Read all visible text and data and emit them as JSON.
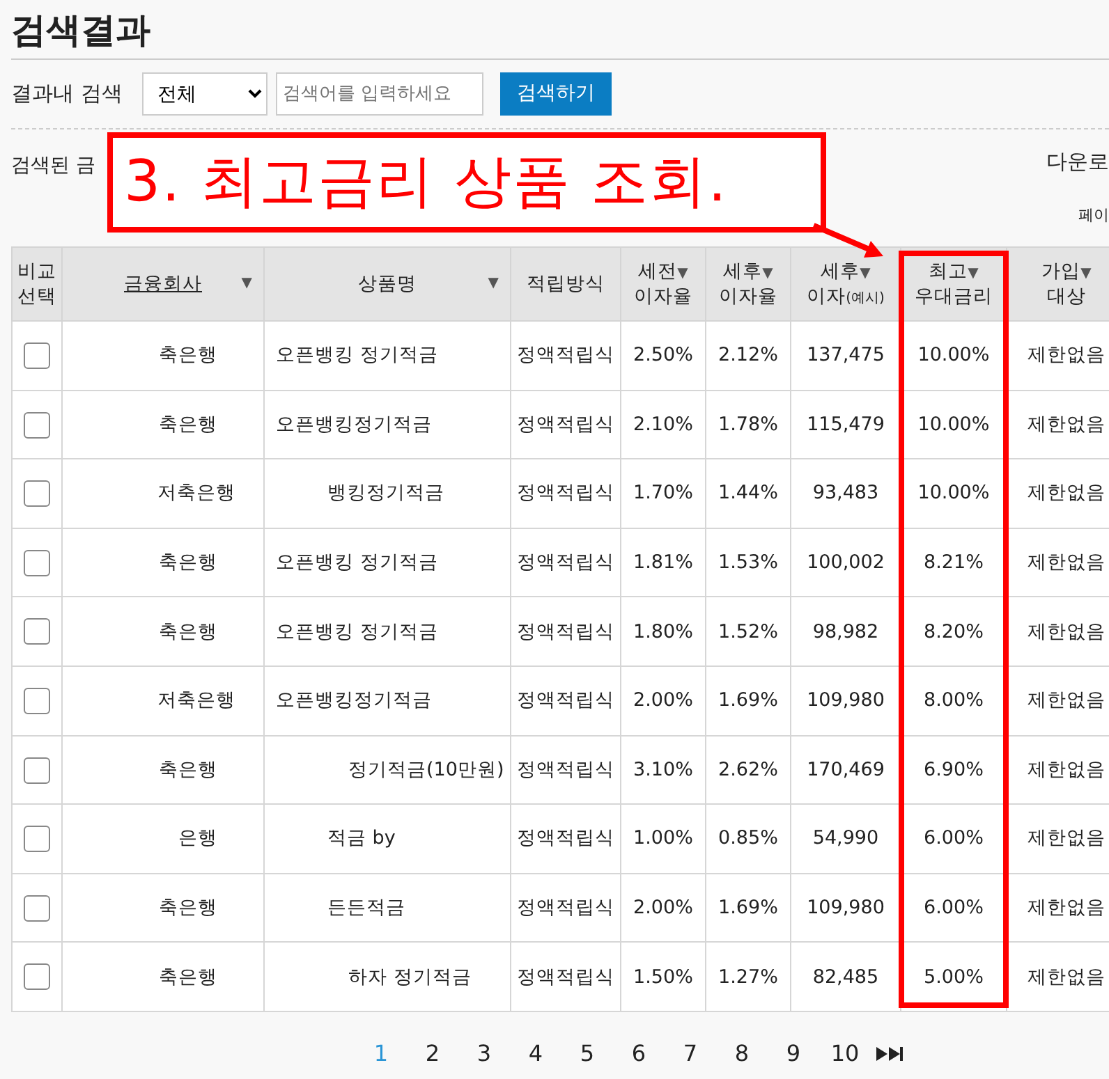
{
  "title": "검색결과",
  "search": {
    "label": "결과내 검색",
    "select": "전체",
    "placeholder": "검색어를 입력하세요",
    "button": "검색하기"
  },
  "result_label": "검색된 금",
  "download": "다운로",
  "page_label": "페이",
  "annotation": {
    "text": "3. 최고금리 상품 조회."
  },
  "columns": [
    {
      "line1": "비교",
      "line2": "선택"
    },
    {
      "line1": "금융회사",
      "arrow": "▼",
      "underline": true
    },
    {
      "line1": "상품명",
      "arrow": "▼"
    },
    {
      "line1": "적립방식"
    },
    {
      "line1": "세전",
      "arrow": "▼",
      "line2": "이자율"
    },
    {
      "line1": "세후",
      "arrow": "▼",
      "line2": "이자율"
    },
    {
      "line1": "세후",
      "arrow": "▼",
      "line2": "이자",
      "note": "(예시)"
    },
    {
      "line1": "최고",
      "arrow": "▼",
      "line2": "우대금리",
      "highlight": true
    },
    {
      "line1": "가입",
      "arrow": "▼",
      "line2": "대상"
    }
  ],
  "rows": [
    {
      "checked": false,
      "company": "축은행",
      "product": "오픈뱅킹 정기적금",
      "method": "정액적립식",
      "pre": "2.50%",
      "post": "2.12%",
      "interest": "137,475",
      "max": "10.00%",
      "target": "제한없음"
    },
    {
      "checked": false,
      "company": "축은행",
      "product": "오픈뱅킹정기적금",
      "method": "정액적립식",
      "pre": "2.10%",
      "post": "1.78%",
      "interest": "115,479",
      "max": "10.00%",
      "target": "제한없음"
    },
    {
      "checked": false,
      "company": "저축은행",
      "product": "뱅킹정기적금",
      "product_offset": true,
      "method": "정액적립식",
      "pre": "1.70%",
      "post": "1.44%",
      "interest": "93,483",
      "max": "10.00%",
      "target": "제한없음"
    },
    {
      "checked": false,
      "company": "축은행",
      "product": "오픈뱅킹 정기적금",
      "method": "정액적립식",
      "pre": "1.81%",
      "post": "1.53%",
      "interest": "100,002",
      "max": "8.21%",
      "target": "제한없음"
    },
    {
      "checked": false,
      "company": "축은행",
      "product": "오픈뱅킹 정기적금",
      "method": "정액적립식",
      "pre": "1.80%",
      "post": "1.52%",
      "interest": "98,982",
      "max": "8.20%",
      "target": "제한없음"
    },
    {
      "checked": false,
      "company": "저축은행",
      "product": "오픈뱅킹정기적금",
      "method": "정액적립식",
      "pre": "2.00%",
      "post": "1.69%",
      "interest": "109,980",
      "max": "8.00%",
      "target": "제한없음"
    },
    {
      "checked": false,
      "company": "축은행",
      "product": "정기적금(10만원)",
      "product_offset": true,
      "method": "정액적립식",
      "pre": "3.10%",
      "post": "2.62%",
      "interest": "170,469",
      "max": "6.90%",
      "target": "제한없음"
    },
    {
      "checked": false,
      "company": "은행",
      "product": "적금 by",
      "product_offset": true,
      "method": "정액적립식",
      "pre": "1.00%",
      "post": "0.85%",
      "interest": "54,990",
      "max": "6.00%",
      "target": "제한없음"
    },
    {
      "checked": false,
      "company": "축은행",
      "product": "든든적금",
      "product_offset": true,
      "method": "정액적립식",
      "pre": "2.00%",
      "post": "1.69%",
      "interest": "109,980",
      "max": "6.00%",
      "target": "제한없음"
    },
    {
      "checked": false,
      "company": "축은행",
      "product": "하자 정기적금",
      "product_offset": true,
      "method": "정액적립식",
      "pre": "1.50%",
      "post": "1.27%",
      "interest": "82,485",
      "max": "5.00%",
      "target": "제한없음"
    }
  ],
  "pages": [
    {
      "label": "1",
      "selected": true
    },
    {
      "label": "2",
      "selected": false
    },
    {
      "label": "3",
      "selected": false
    },
    {
      "label": "4",
      "selected": false
    },
    {
      "label": "5",
      "selected": false
    },
    {
      "label": "6",
      "selected": false
    },
    {
      "label": "7",
      "selected": false
    },
    {
      "label": "8",
      "selected": false
    },
    {
      "label": "9",
      "selected": false
    },
    {
      "label": "10",
      "selected": false
    }
  ]
}
